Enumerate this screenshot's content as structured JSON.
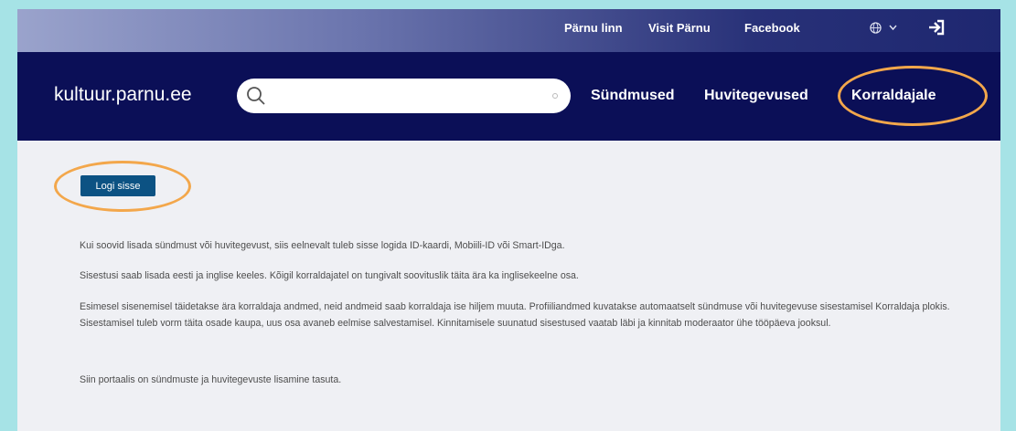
{
  "topbar": {
    "links": [
      "Pärnu linn",
      "Visit Pärnu",
      "Facebook"
    ],
    "language_icon": "globe-icon",
    "login_icon": "sign-in-icon"
  },
  "header": {
    "logo": "kultuur.parnu.ee",
    "search": {
      "value": "",
      "placeholder": ""
    },
    "nav": [
      "Sündmused",
      "Huvitegevused",
      "Korraldajale"
    ]
  },
  "main": {
    "login_button": "Logi sisse",
    "paragraphs": [
      "Kui soovid lisada sündmust või huvitegevust, siis eelnevalt tuleb sisse logida ID-kaardi, Mobiili-ID või Smart-IDga.",
      "Sisestusi saab lisada eesti ja inglise keeles. Kõigil korraldajatel on tungivalt soovituslik täita ära ka inglisekeelne osa.",
      "Esimesel sisenemisel täidetakse ära korraldaja andmed, neid andmeid saab korraldaja ise hiljem muuta. Profiiliandmed kuvatakse automaatselt sündmuse või huvitegevuse sisestamisel Korraldaja plokis. Sisestamisel tuleb vorm täita osade kaupa, uus osa avaneb eelmise salvestamisel. Kinnitamisele suunatud sisestused vaatab läbi ja kinnitab moderaator ühe tööpäeva jooksul.",
      "Siin portaalis on sündmuste ja huvitegevuste lisamine tasuta."
    ]
  },
  "colors": {
    "navbar": "#0b0f57",
    "button": "#0c5283",
    "annotation": "#f3a74b",
    "background": "#a6e3e6"
  }
}
